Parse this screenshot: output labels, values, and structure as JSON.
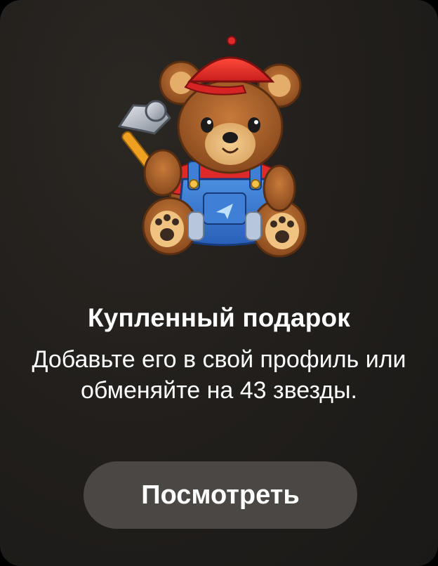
{
  "gift": {
    "sticker_icon": "teddy-bear-with-hammer-sticker",
    "title": "Купленный подарок",
    "description": "Добавьте его в свой профиль или обменяйте на 43 звезды.",
    "button_label": "Посмотреть"
  },
  "colors": {
    "background": "#231f1c",
    "button": "#4a4744",
    "text": "#ffffff"
  }
}
